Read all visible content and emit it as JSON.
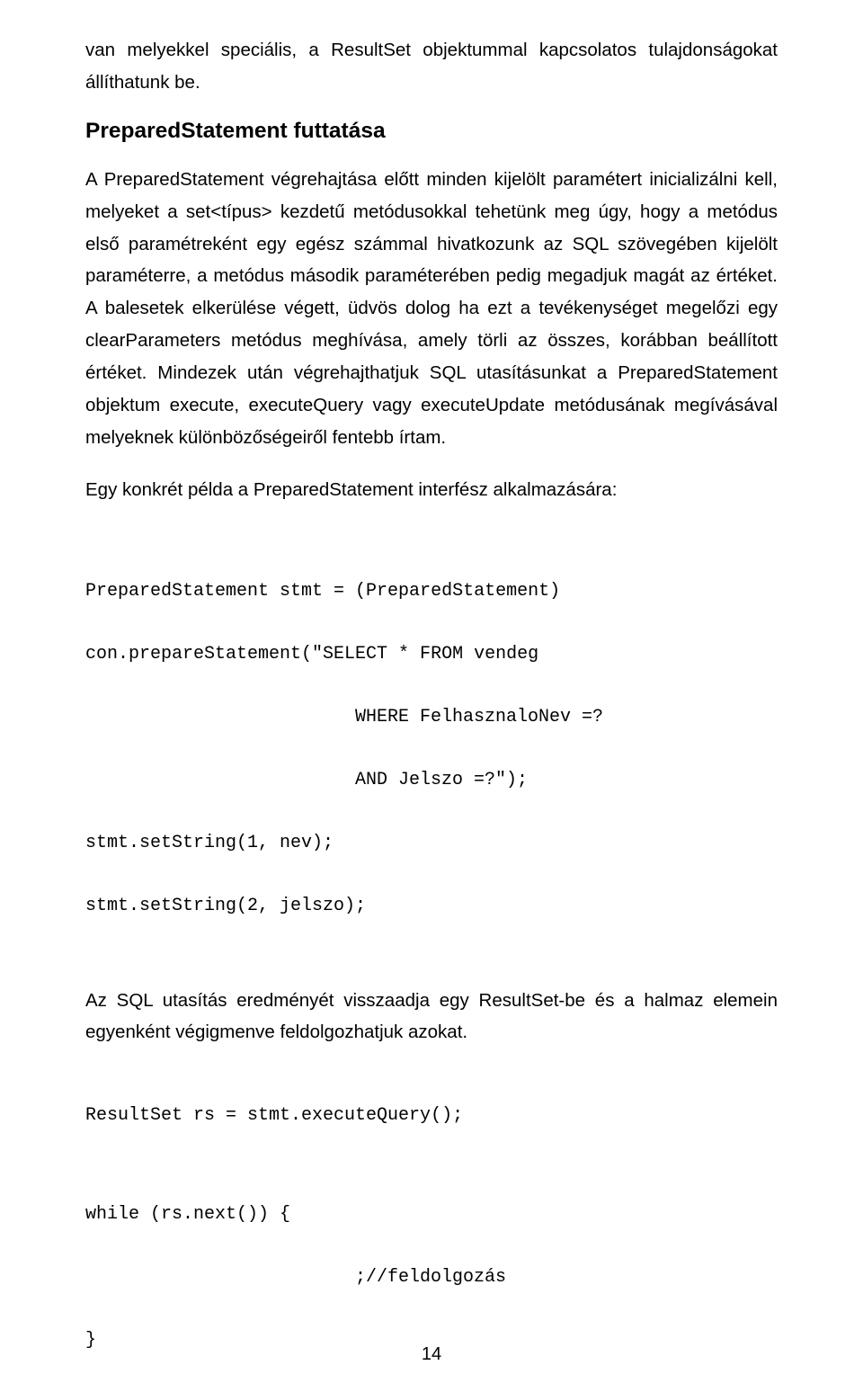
{
  "para1": "van melyekkel speciális, a ResultSet objektummal kapcsolatos tulajdonságokat állíthatunk be.",
  "heading": "PreparedStatement futtatása",
  "para2": "A PreparedStatement végrehajtása előtt minden kijelölt paramétert inicializálni kell, melyeket a set<típus> kezdetű metódusokkal tehetünk meg úgy, hogy a metódus első paramétreként egy egész számmal hivatkozunk az SQL szövegében kijelölt paraméterre, a metódus második paraméterében pedig megadjuk magát az értéket. A balesetek elkerülése végett, üdvös dolog ha ezt a tevékenységet megelőzi egy clearParameters metódus meghívása, amely törli az összes, korábban beállított értéket. Mindezek után végrehajthatjuk SQL utasításunkat a PreparedStatement objektum execute, executeQuery vagy executeUpdate metódusának megívásával melyeknek különbözőségeiről fentebb írtam.",
  "para3": "Egy konkrét példa a PreparedStatement interfész alkalmazására:",
  "code1": {
    "l1": "PreparedStatement stmt = (PreparedStatement)",
    "l2": "con.prepareStatement(\"SELECT * FROM vendeg",
    "l3": "WHERE FelhasznaloNev =?",
    "l4": "AND Jelszo =?\");",
    "l5": "stmt.setString(1, nev);",
    "l6": "stmt.setString(2, jelszo);"
  },
  "para4": "Az SQL utasítás eredményét visszaadja egy ResultSet-be és a halmaz elemein egyenként végigmenve feldolgozhatjuk azokat.",
  "code2": {
    "l1": "ResultSet rs = stmt.executeQuery();"
  },
  "code3": {
    "l1": "while (rs.next()) {",
    "l2": ";//feldolgozás",
    "l3": "}"
  },
  "pageNumber": "14"
}
